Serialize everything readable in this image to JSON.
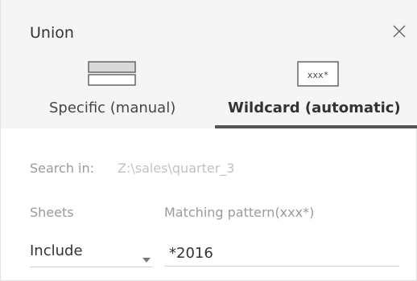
{
  "dialog": {
    "title": "Union",
    "close_icon": "close-icon"
  },
  "tabs": [
    {
      "label": "Specific (manual)",
      "icon": "stacked-tables-icon",
      "selected": false
    },
    {
      "label": "Wildcard (automatic)",
      "icon": "wildcard-icon",
      "icon_text": "xxx*",
      "selected": true
    }
  ],
  "search": {
    "label": "Search in:",
    "value": "Z:\\sales\\quarter_3"
  },
  "sheets": {
    "label": "Sheets",
    "selected": "Include"
  },
  "pattern": {
    "label": "Matching pattern(xxx*)",
    "value": "*2016"
  },
  "colors": {
    "header_bg": "#f5f5f5",
    "selected_underline": "#555555",
    "muted_text": "#9a9a9a"
  }
}
